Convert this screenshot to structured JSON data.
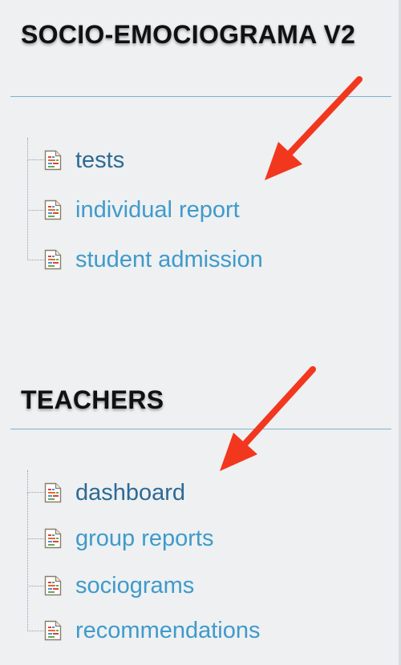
{
  "sections": [
    {
      "title": "SOCIO-EMOCIOGRAMA V2",
      "items": [
        {
          "label": "tests",
          "icon": "document-icon",
          "color": "#2d6a95"
        },
        {
          "label": "individual report",
          "icon": "document-icon",
          "color": "#3f9acb"
        },
        {
          "label": "student admission",
          "icon": "document-icon",
          "color": "#3f9acb"
        }
      ]
    },
    {
      "title": "TEACHERS",
      "items": [
        {
          "label": "dashboard",
          "icon": "document-icon",
          "color": "#2d6a95"
        },
        {
          "label": "group reports",
          "icon": "document-icon",
          "color": "#3f9acb"
        },
        {
          "label": "sociograms",
          "icon": "document-icon",
          "color": "#3f9acb"
        },
        {
          "label": "recommendations",
          "icon": "document-icon",
          "color": "#3f9acb"
        }
      ]
    }
  ],
  "annotations": {
    "arrow_color": "#f2371f",
    "arrow_icon": "red-arrow-annotation"
  },
  "colors": {
    "background": "#eef0f1",
    "rule": "#7cb3cf",
    "heading": "#111111"
  }
}
